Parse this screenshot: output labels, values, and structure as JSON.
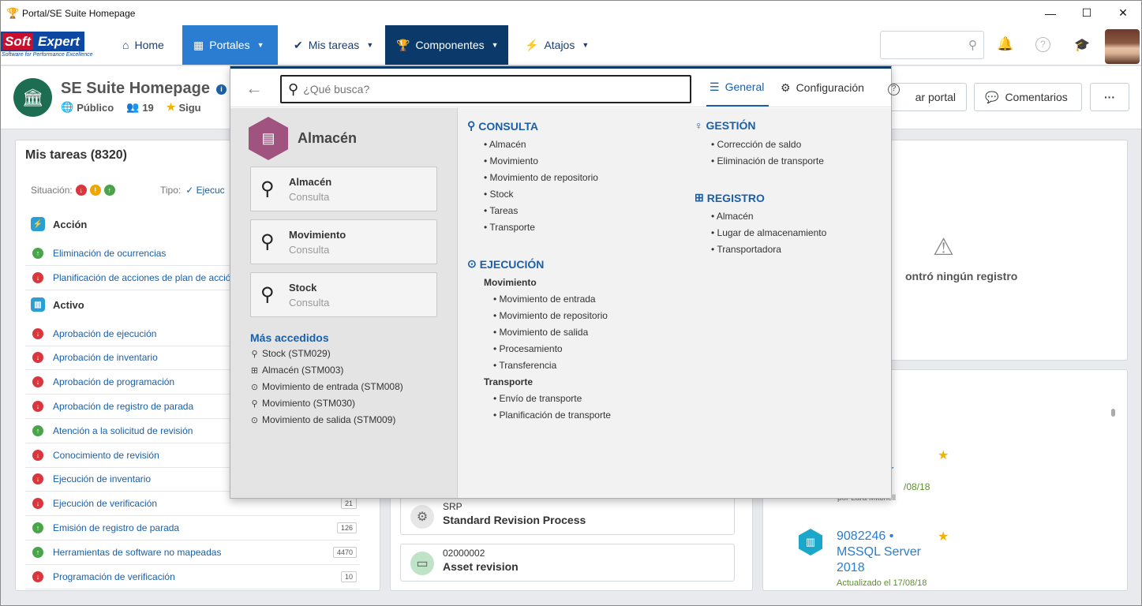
{
  "window": {
    "title": "Portal/SE Suite Homepage"
  },
  "logo": {
    "soft": "Soft",
    "expert": "Expert",
    "tagline": "Software for Performance Excellence"
  },
  "nav": {
    "home": "Home",
    "portales": "Portales",
    "mis_tareas": "Mis tareas",
    "componentes": "Componentes",
    "atajos": "Atajos"
  },
  "page": {
    "title": "SE Suite Homepage",
    "visibility": "Público",
    "followers": "19",
    "follow": "Sigu",
    "btn_portal": "ar portal",
    "btn_comentarios": "Comentarios",
    "btn_more": "···"
  },
  "tasks": {
    "title": "Mis tareas (8320)",
    "situacion_label": "Situación:",
    "tipo_label": "Tipo:",
    "tipo_value": "Ejecuc",
    "sections": [
      {
        "name": "Acción"
      },
      {
        "name": "Activo"
      }
    ],
    "accion_items": [
      {
        "label": "Eliminación de ocurrencias",
        "status": "green",
        "count": ""
      },
      {
        "label": "Planificación de acciones de plan de acció",
        "status": "red",
        "count": ""
      }
    ],
    "activo_items": [
      {
        "label": "Aprobación de ejecución",
        "status": "red",
        "count": ""
      },
      {
        "label": "Aprobación de inventario",
        "status": "red",
        "count": ""
      },
      {
        "label": "Aprobación de programación",
        "status": "red",
        "count": ""
      },
      {
        "label": "Aprobación de registro de parada",
        "status": "red",
        "count": ""
      },
      {
        "label": "Atención a la solicitud de revisión",
        "status": "green",
        "count": ""
      },
      {
        "label": "Conocimiento de revisión",
        "status": "red",
        "count": ""
      },
      {
        "label": "Ejecución de inventario",
        "status": "red",
        "count": ""
      },
      {
        "label": "Ejecución de verificación",
        "status": "red",
        "count": "21"
      },
      {
        "label": "Emisión de registro de parada",
        "status": "green",
        "count": "126"
      },
      {
        "label": "Herramientas de software no mapeadas",
        "status": "green",
        "count": "4470"
      },
      {
        "label": "Programación de verificación",
        "status": "red",
        "count": "10"
      }
    ]
  },
  "middle": {
    "items": [
      {
        "code": "SRP",
        "name": "Standard Revision Process",
        "icon": "gear-icon"
      },
      {
        "code": "02000002",
        "name": "Asset revision",
        "icon": "monitor-icon"
      }
    ]
  },
  "right1": {
    "empty_text": "ontró ningún registro"
  },
  "right2": {
    "frag_title": "er",
    "frag_date": "/08/18",
    "frag_by": "por Lara Mitchell",
    "item_title": "9082246 • MSSQL Server 2018",
    "item_date": "Actualizado el 17/08/18"
  },
  "dropdown": {
    "search_placeholder": "¿Qué busca?",
    "tab_general": "General",
    "tab_config": "Configuración",
    "component_name": "Almacén",
    "quick_buttons": [
      {
        "title": "Almacén",
        "sub": "Consulta"
      },
      {
        "title": "Movimiento",
        "sub": "Consulta"
      },
      {
        "title": "Stock",
        "sub": "Consulta"
      }
    ],
    "mas_accedidos_title": "Más accedidos",
    "mas_accedidos": [
      {
        "label": "Stock (STM029)",
        "icon": "search-icon"
      },
      {
        "label": "Almacén (STM003)",
        "icon": "plus-square-icon"
      },
      {
        "label": "Movimiento de entrada (STM008)",
        "icon": "play-circle-icon"
      },
      {
        "label": "Movimiento (STM030)",
        "icon": "search-icon"
      },
      {
        "label": "Movimiento de salida (STM009)",
        "icon": "play-circle-icon"
      }
    ],
    "consulta": {
      "title": "CONSULTA",
      "items": [
        "• Almacén",
        "• Movimiento",
        "• Movimiento de repositorio",
        "• Stock",
        "• Tareas",
        "• Transporte"
      ]
    },
    "ejecucion": {
      "title": "EJECUCIÓN",
      "sub1": "Movimiento",
      "sub1_items": [
        "• Movimiento de entrada",
        "• Movimiento de repositorio",
        "• Movimiento de salida",
        "• Procesamiento",
        "• Transferencia"
      ],
      "sub2": "Transporte",
      "sub2_items": [
        "• Envío de transporte",
        "• Planificación de transporte"
      ]
    },
    "gestion": {
      "title": "GESTIÓN",
      "items": [
        "• Corrección de saldo",
        "• Eliminación de transporte"
      ]
    },
    "registro": {
      "title": "REGISTRO",
      "items": [
        "• Almacén",
        "• Lugar de almacenamiento",
        "• Transportadora"
      ]
    }
  }
}
